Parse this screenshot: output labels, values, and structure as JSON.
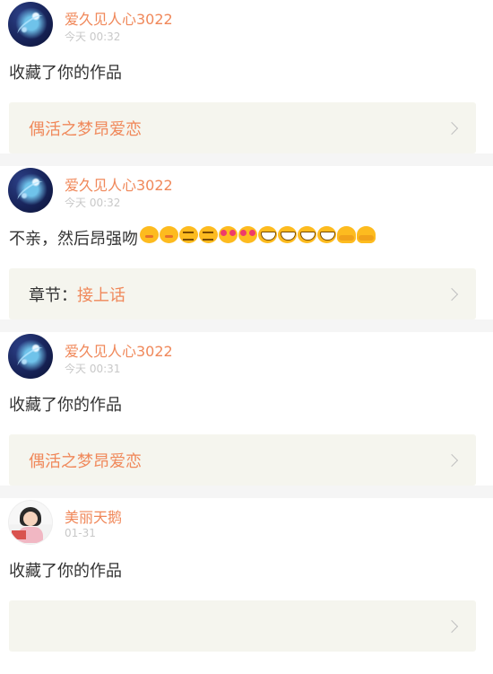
{
  "feed": [
    {
      "user": "爱久见人心3022",
      "time": "今天 00:32",
      "avatar": "galaxy-avatar",
      "text": "收藏了你的作品",
      "link_prefix": "",
      "link_title": "偶活之梦昂爱恋"
    },
    {
      "user": "爱久见人心3022",
      "time": "今天 00:32",
      "avatar": "galaxy-avatar",
      "text": "不亲，然后昂强吻",
      "emojis": [
        "kiss",
        "kiss",
        "wink",
        "wink",
        "love",
        "love",
        "grin",
        "grin",
        "grin",
        "grin",
        "hug",
        "hug"
      ],
      "link_prefix": "章节：",
      "link_title": "接上话"
    },
    {
      "user": "爱久见人心3022",
      "time": "今天 00:31",
      "avatar": "galaxy-avatar",
      "text": "收藏了你的作品",
      "link_prefix": "",
      "link_title": "偶活之梦昂爱恋"
    },
    {
      "user": "美丽天鹅",
      "time": "01-31",
      "avatar": "girl-avatar",
      "text": "收藏了你的作品",
      "link_prefix": "",
      "link_title": ""
    }
  ]
}
